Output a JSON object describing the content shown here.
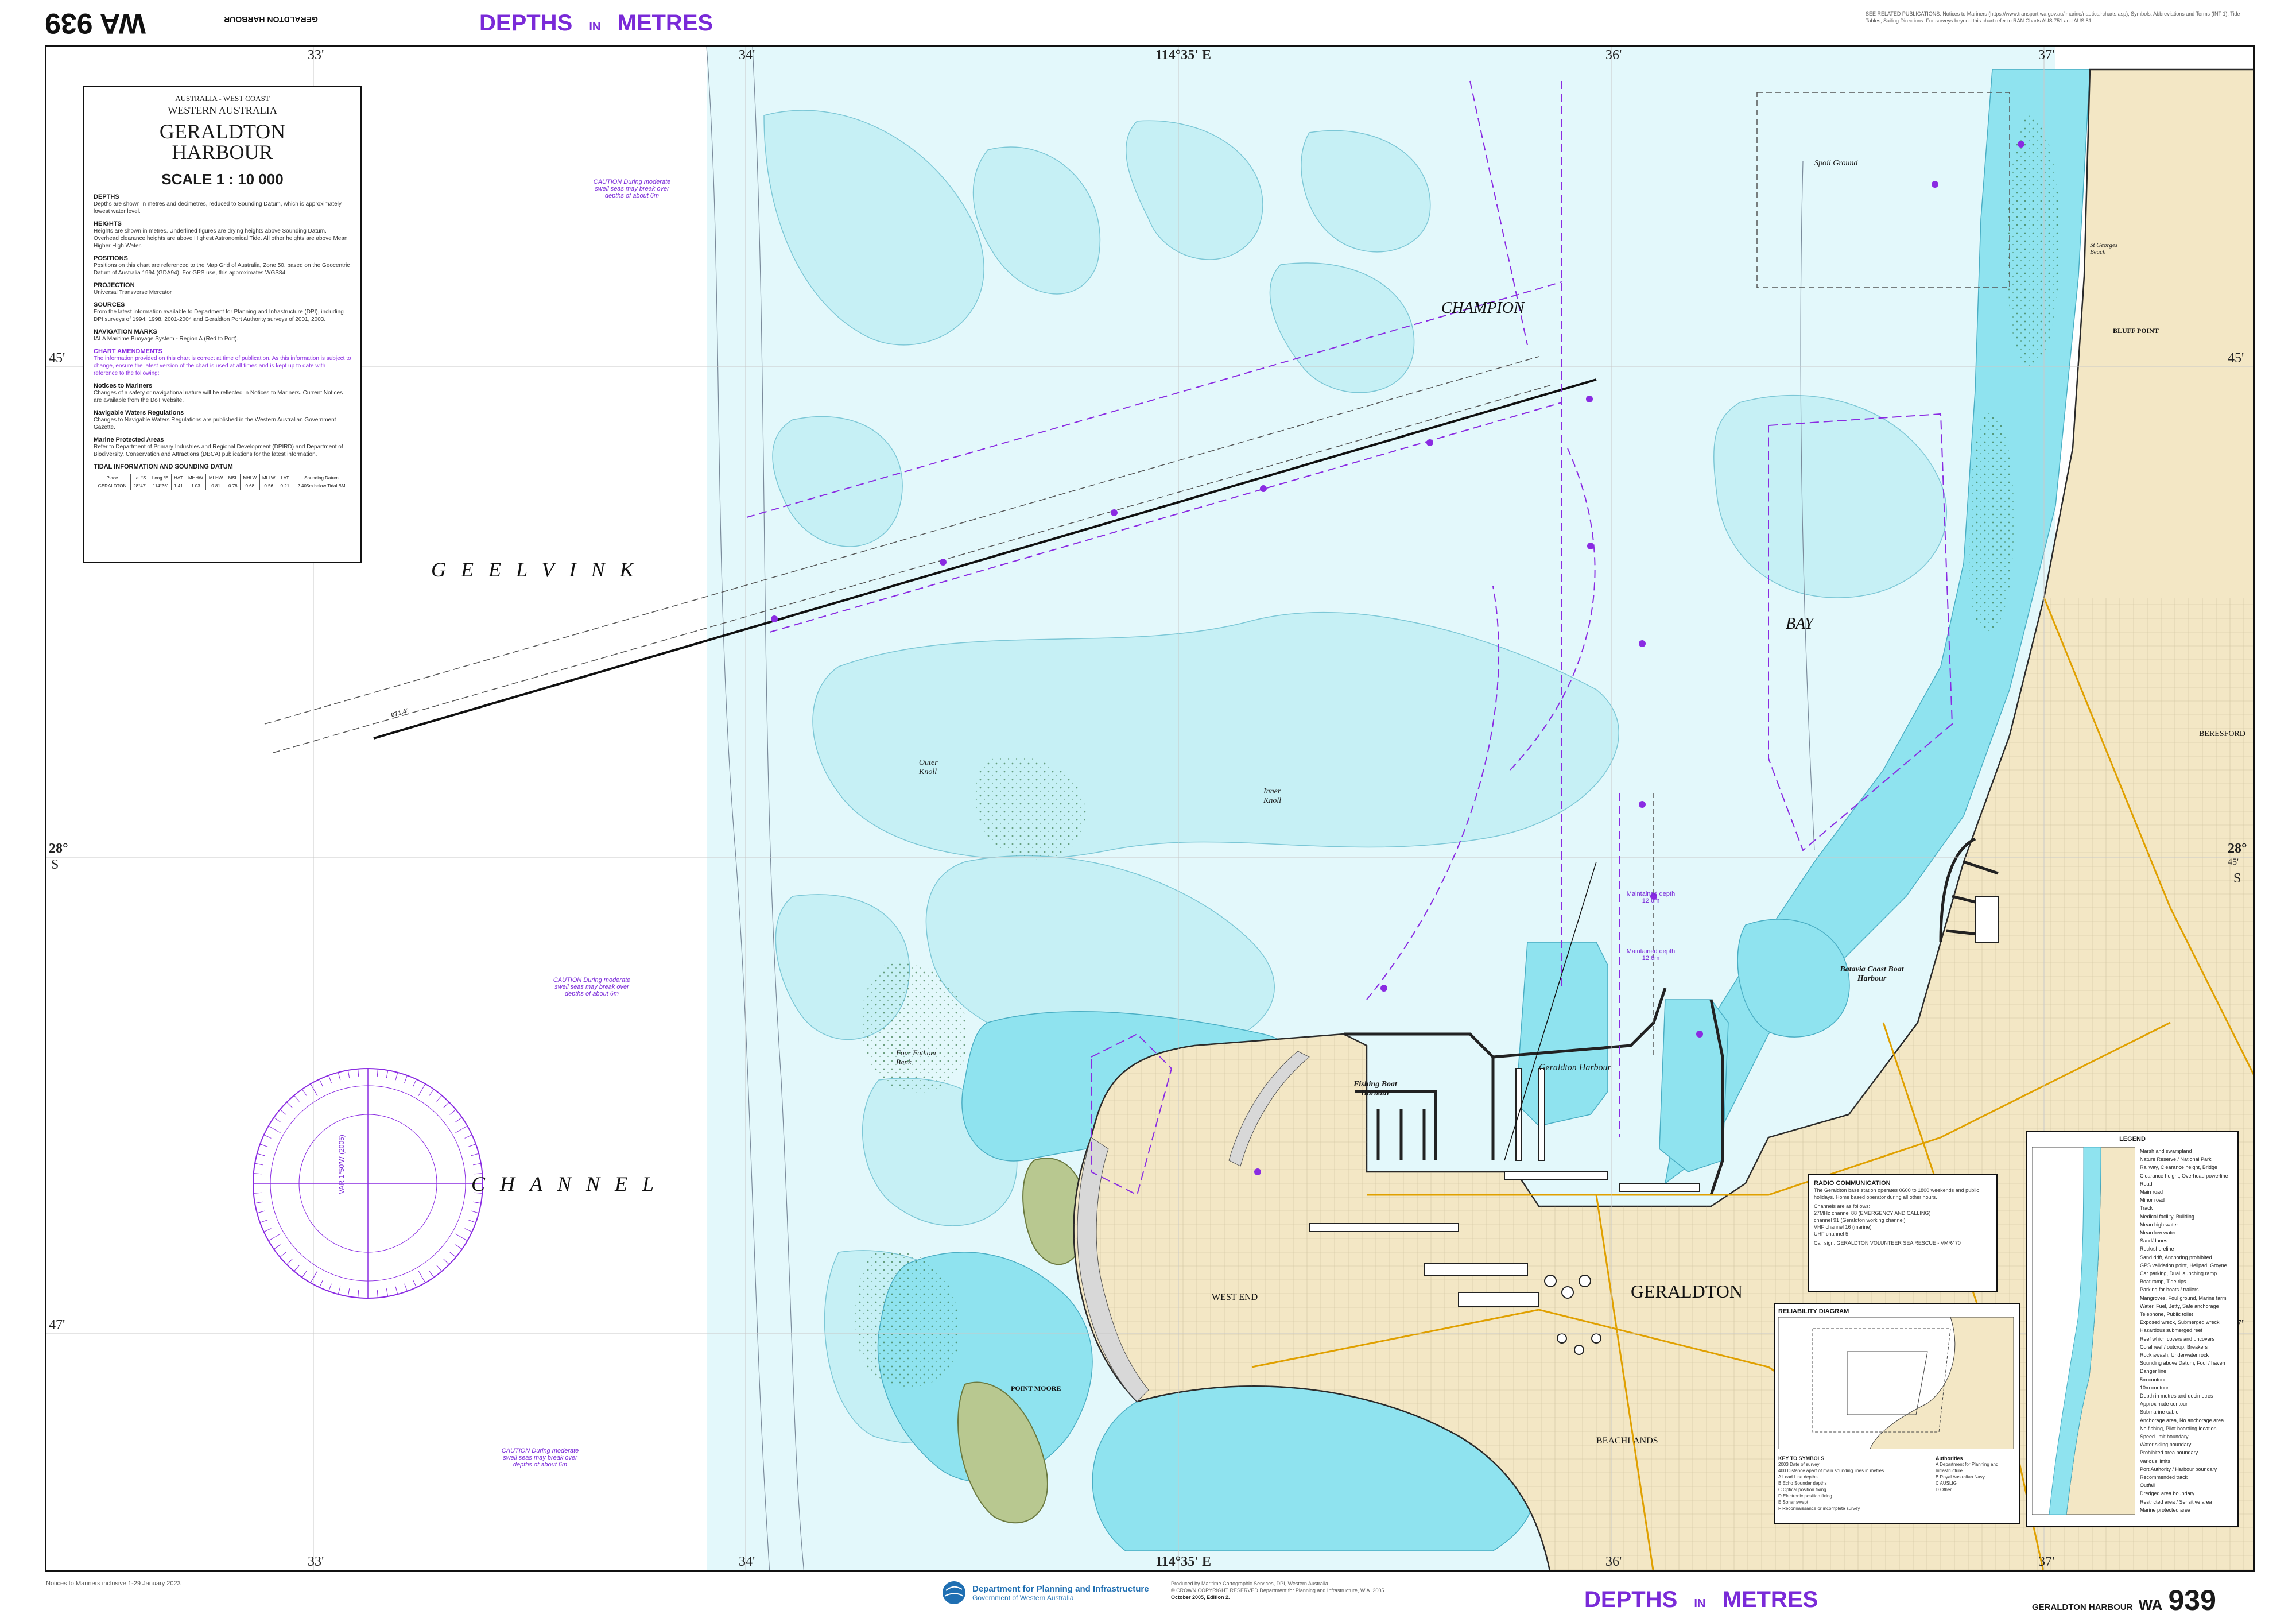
{
  "header": {
    "chart_number": "WA 939",
    "chart_number_short": "939",
    "chart_title_rotated": "GERALDTON HARBOUR",
    "depths_label_left": "DEPTHS",
    "depths_in": "IN",
    "depths_label_right": "METRES",
    "related_publications": "SEE RELATED PUBLICATIONS: Notices to Mariners (https://www.transport.wa.gov.au/imarine/nautical-charts.asp), Symbols, Abbreviations and Terms (INT 1), Tide Tables, Sailing Directions. For surveys beyond this chart refer to RAN Charts AUS 751 and AUS 81."
  },
  "footer": {
    "notices": "Notices to Mariners inclusive 1-29 January 2023",
    "department": "Department for Planning and Infrastructure",
    "government": "Government of Western Australia",
    "produced_by": "Produced by Maritime Cartographic Services, DPI, Western Australia",
    "copyright": "© CROWN COPYRIGHT RESERVED Department for Planning and Infrastructure, W.A. 2005",
    "edition": "October 2005, Edition 2.",
    "bottom_title": "GERALDTON HARBOUR",
    "bottom_chart": "WA",
    "bottom_number": "939",
    "depths_label_left": "DEPTHS",
    "depths_in": "IN",
    "depths_label_right": "METRES"
  },
  "graticule": {
    "lon_top": [
      "33'",
      "34'",
      "114°35' E",
      "36'",
      "37'"
    ],
    "lon_bottom": [
      "33'",
      "34'",
      "114°35' E",
      "36'",
      "37'"
    ],
    "lat_left": [
      "45'",
      "28°",
      "S",
      "47'"
    ],
    "lat_right": [
      "45'",
      "28°",
      "45'",
      "S",
      "47'"
    ]
  },
  "title_panel": {
    "line1": "AUSTRALIA - WEST COAST",
    "line2": "WESTERN AUSTRALIA",
    "title_a": "GERALDTON",
    "title_b": "HARBOUR",
    "scale": "SCALE   1 : 10 000",
    "depths_head": "DEPTHS",
    "depths_text": "Depths are shown in metres and decimetres, reduced to Sounding Datum, which is approximately lowest water level.",
    "heights_head": "HEIGHTS",
    "heights_text": "Heights are shown in metres. Underlined figures are drying heights above Sounding Datum. Overhead clearance heights are above Highest Astronomical Tide. All other heights are above Mean Higher High Water.",
    "positions_head": "POSITIONS",
    "positions_text": "Positions on this chart are referenced to the Map Grid of Australia, Zone 50, based on the Geocentric Datum of Australia 1994 (GDA94). For GPS use, this approximates WGS84.",
    "projection_head": "PROJECTION",
    "projection_text": "Universal Transverse Mercator",
    "sources_head": "SOURCES",
    "sources_text": "From the latest information available to Department for Planning and Infrastructure (DPI), including DPI surveys of 1994, 1998, 2001-2004 and Geraldton Port Authority surveys of 2001, 2003.",
    "navmarks_head": "NAVIGATION MARKS",
    "navmarks_text": "IALA Maritime Buoyage System - Region A (Red to Port).",
    "amend_head": "CHART AMENDMENTS",
    "amend_text": "The information provided on this chart is correct at time of publication. As this information is subject to change, ensure the latest version of the chart is used at all times and is kept up to date with reference to the following:",
    "notices_head": "Notices to Mariners",
    "notices_text": "Changes of a safety or navigational nature will be reflected in Notices to Mariners. Current Notices are available from the DoT website.",
    "regs_head": "Navigable Waters Regulations",
    "regs_text": "Changes to Navigable Waters Regulations are published in the Western Australian Government Gazette.",
    "mpa_head": "Marine Protected Areas",
    "mpa_text": "Refer to Department of Primary Industries and Regional Development (DPIRD) and Department of Biodiversity, Conservation and Attractions (DBCA) publications for the latest information.",
    "tidal_head": "TIDAL INFORMATION AND SOUNDING DATUM",
    "tidal_columns": [
      "Place",
      "Lat °S",
      "Long °E",
      "HAT",
      "MHHW",
      "MLHW",
      "MSL",
      "MHLW",
      "MLLW",
      "LAT",
      "Sounding Datum"
    ],
    "tidal_row": [
      "GERALDTON",
      "28°47'",
      "114°36'",
      "1.41",
      "1.03",
      "0.81",
      "0.78",
      "0.68",
      "0.56",
      "0.21",
      "2.405m below Tidal BM"
    ]
  },
  "places": {
    "geelvink": "GEELVINK",
    "channel": "CHANNEL",
    "champion": "CHAMPION",
    "bay": "BAY",
    "geraldton": "GERALDTON",
    "west_end": "WEST END",
    "beachlands": "BEACHLANDS",
    "beresford": "BERESFORD",
    "bluff_point": "BLUFF POINT",
    "point_moore": "POINT MOORE",
    "geraldton_harbour": "Geraldton     Harbour",
    "fishing_boat_harbour": "Fishing Boat Harbour",
    "batavia_coast": "Batavia Coast Boat Harbour",
    "outer_knoll": "Outer Knoll",
    "inner_knoll": "Inner Knoll",
    "four_fathom_bank": "Four Fathom Bank",
    "spoil_ground": "Spoil Ground",
    "st_georges_beach": "St Georges Beach"
  },
  "nav_lines": {
    "leading_bearing": "071.4°",
    "maintained_depth_1": "Maintained depth 12.6m",
    "maintained_depth_2": "Maintained depth 12.6m",
    "caution_1": "CAUTION During moderate swell seas may break over depths of about 6m",
    "caution_2": "CAUTION During moderate swell seas may break over depths of about 6m",
    "caution_3": "CAUTION During moderate swell seas may break over depths of about 6m",
    "compass_var": "VAR 1°50'W (2005)"
  },
  "radio": {
    "head": "RADIO COMMUNICATION",
    "text": "The Geraldton base station operates 0600 to 1800 weekends and public holidays. Home based operator during all other hours.",
    "ch_head": "Channels are as follows:",
    "c1": "27MHz  channel 88 (EMERGENCY AND CALLING)",
    "c2": "        channel 91 (Geraldton working channel)",
    "c3": "VHF    channel 16 (marine)",
    "c4": "UHF    channel 5",
    "callsign": "Call sign: GERALDTON VOLUNTEER SEA RESCUE - VMR470"
  },
  "reliability": {
    "head": "RELIABILITY DIAGRAM",
    "key_head": "KEY TO SYMBOLS",
    "key_items": [
      "2003  Date of survey",
      "400  Distance apart of main sounding lines in metres",
      "A  Lead Line depths",
      "B  Echo Sounder depths",
      "C  Optical position fixing",
      "D  Electronic position fixing",
      "E  Sonar swept",
      "F  Reconnaissance or incomplete survey"
    ],
    "auth_head": "Authorities",
    "auth_items": [
      "A  Department for Planning and Infrastructure",
      "B  Royal Australian Navy",
      "C  AUSLIG",
      "D  Other"
    ]
  },
  "legend": {
    "head": "LEGEND",
    "items": [
      "Marsh and swampland",
      "Nature Reserve / National Park",
      "Railway, Clearance height, Bridge",
      "Clearance height, Overhead powerline",
      "Road",
      "Main road",
      "Minor road",
      "Track",
      "Medical facility, Building",
      "Mean high water",
      "Mean low water",
      "Sand/dunes",
      "Rock/shoreline",
      "Sand drift, Anchoring prohibited",
      "GPS validation point, Helipad, Groyne",
      "Car parking, Dual launching ramp",
      "Boat ramp, Tide rips",
      "Parking for boats / trailers",
      "Mangroves, Foul ground, Marine farm",
      "Water, Fuel, Jetty, Safe anchorage",
      "Telephone, Public toilet",
      "Exposed wreck, Submerged wreck",
      "Hazardous submerged reef",
      "Reef which covers and uncovers",
      "Coral reef / outcrop, Breakers",
      "Rock awash, Underwater rock",
      "Sounding above Datum, Foul / haven",
      "Danger line",
      "5m contour",
      "10m contour",
      "Depth in metres and decimetres",
      "Approximate contour",
      "Submarine cable",
      "Anchorage area, No anchorage area",
      "No fishing, Pilot boarding location",
      "Speed limit boundary",
      "Water skiing boundary",
      "Prohibited area boundary",
      "Various limits",
      "Port Authority / Harbour boundary",
      "Recommended track",
      "Outfall",
      "Dredged area boundary",
      "Restricted area / Sensitive area",
      "Marine protected area"
    ]
  },
  "colors": {
    "land": "#f3e7c5",
    "shoal": "#8fe3ef",
    "shallow": "#c6f0f5",
    "mid": "#e3f8fb",
    "deep": "#ffffff",
    "reef": "#b8c890",
    "magenta": "#8a2be2",
    "header_purple": "#7a2ad8"
  }
}
